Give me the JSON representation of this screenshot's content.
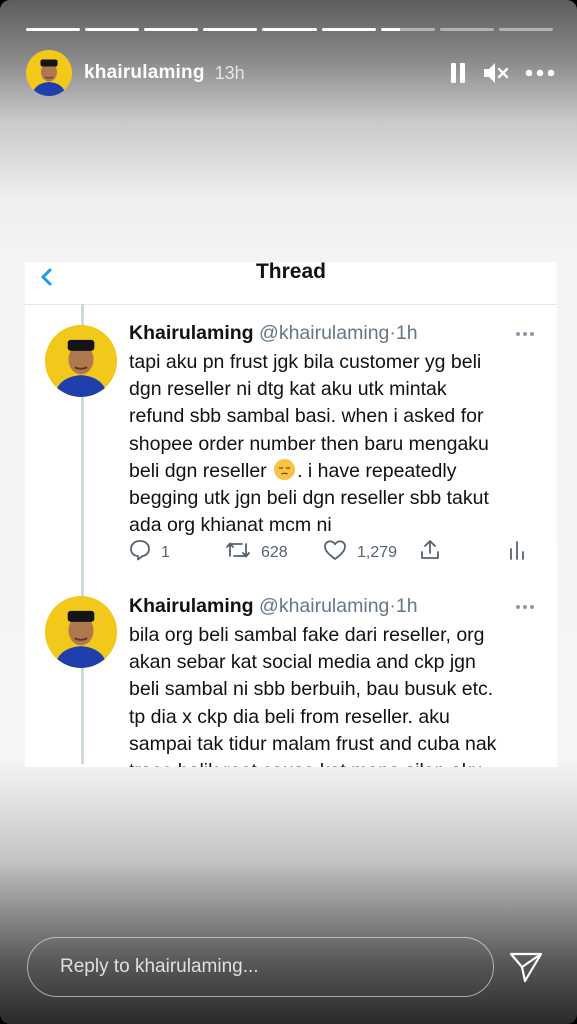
{
  "story": {
    "progress_segments": [
      1,
      1,
      1,
      1,
      1,
      1,
      0.35,
      0,
      0
    ],
    "username": "khairulaming",
    "time_ago": "13h",
    "icons": [
      "pause-icon",
      "mute-icon",
      "more-icon"
    ]
  },
  "thread": {
    "title": "Thread",
    "tweets": [
      {
        "name": "Khairulaming",
        "handle": "@khairulaming",
        "sep": "·",
        "time": "1h",
        "lines": [
          "tapi aku pn frust jgk bila customer yg beli",
          "dgn reseller ni dtg kat aku utk mintak",
          "refund sbb sambal basi. when i asked for",
          "shopee order number then baru mengaku",
          "beli dgn reseller",
          ". i have repeatedly",
          "begging utk jgn beli dgn reseller sbb takut",
          "ada org khianat mcm ni"
        ],
        "replies": "1",
        "retweets": "628",
        "likes": "1,279"
      },
      {
        "name": "Khairulaming",
        "handle": "@khairulaming",
        "sep": "·",
        "time": "1h",
        "lines": [
          "bila org beli sambal fake dari reseller, org",
          "akan sebar kat social media and ckp jgn",
          "beli sambal ni sbb berbuih, bau busuk etc.",
          "tp dia x ckp dia beli from reseller. aku",
          "sampai tak tidur malam frust and cuba nak",
          "trace balik root cause kat mana silap aku"
        ]
      }
    ]
  },
  "reply": {
    "placeholder": "Reply to khairulaming..."
  },
  "colors": {
    "avatar_bg": "#f2c81a",
    "handle_gray": "#657786",
    "action_gray": "#536471"
  }
}
